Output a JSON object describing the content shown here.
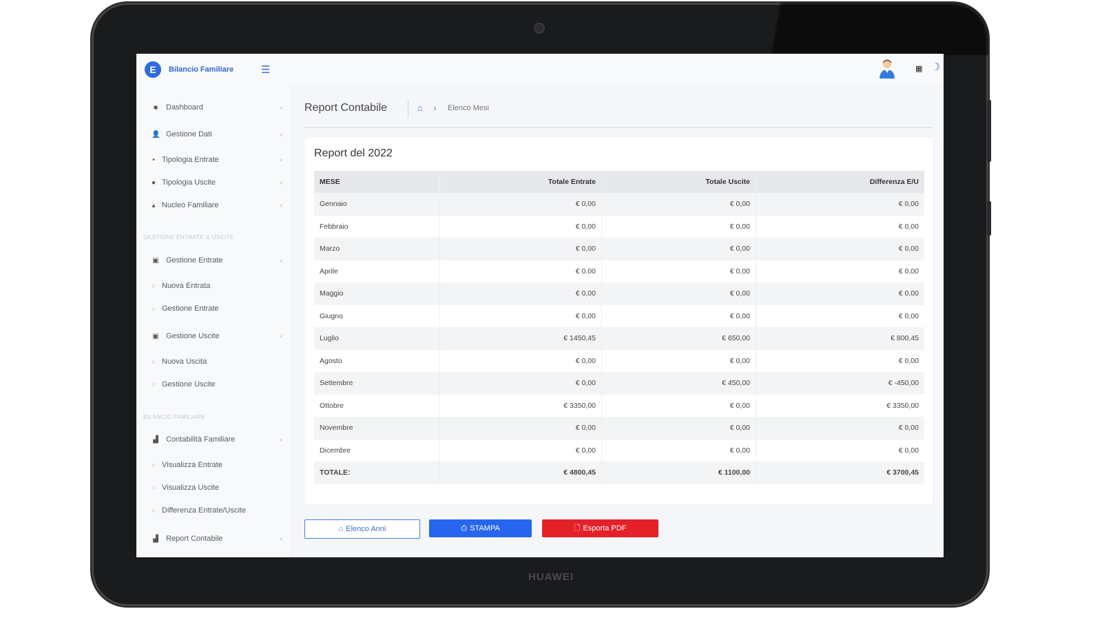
{
  "device": {
    "brand": "HUAWEI"
  },
  "app": {
    "logo_letter": "E",
    "title": "Bilancio Familiare"
  },
  "sidebar": {
    "items": [
      {
        "label": "Dashboard",
        "icon": "home-icon"
      },
      {
        "label": "Gestione Dati",
        "icon": "user-icon"
      },
      {
        "label": "Tipologia Entrate",
        "icon": "dot-icon"
      },
      {
        "label": "Tipologia Uscite",
        "icon": "dot-icon"
      },
      {
        "label": "Nucleo Familiare",
        "icon": "dot-icon"
      }
    ],
    "section1": "GESTIONE ENTRATE & USCITE",
    "entrate": {
      "label": "Gestione Entrate",
      "sub": [
        "Nuova Entrata",
        "Gestione Entrate"
      ]
    },
    "uscite": {
      "label": "Gestione Uscite",
      "sub": [
        "Nuova Uscita",
        "Gestione Uscite"
      ]
    },
    "section2": "BILANCIO FAMILIARE",
    "contabilita": {
      "label": "Contabilità Familiare",
      "sub": [
        "Visualizza Entrate",
        "Visualizza Uscite",
        "Differenza Entrate/Uscite"
      ]
    },
    "report": {
      "label": "Report Contabile"
    }
  },
  "breadcrumb": {
    "title": "Report Contabile",
    "current": "Elenco Mesi"
  },
  "report": {
    "title": "Report del 2022",
    "headers": [
      "MESE",
      "Totale Entrate",
      "Totale Uscite",
      "Differenza E/U"
    ],
    "rows": [
      [
        "Gennaio",
        "€ 0,00",
        "€ 0,00",
        "€ 0,00"
      ],
      [
        "Febbraio",
        "€ 0,00",
        "€ 0,00",
        "€ 0,00"
      ],
      [
        "Marzo",
        "€ 0,00",
        "€ 0,00",
        "€ 0,00"
      ],
      [
        "Aprile",
        "€ 0,00",
        "€ 0,00",
        "€ 0,00"
      ],
      [
        "Maggio",
        "€ 0,00",
        "€ 0,00",
        "€ 0,00"
      ],
      [
        "Giugno",
        "€ 0,00",
        "€ 0,00",
        "€ 0,00"
      ],
      [
        "Luglio",
        "€ 1450,45",
        "€ 650,00",
        "€ 800,45"
      ],
      [
        "Agosto",
        "€ 0,00",
        "€ 0,00",
        "€ 0,00"
      ],
      [
        "Settembre",
        "€ 0,00",
        "€ 450,00",
        "€ -450,00"
      ],
      [
        "Ottobre",
        "€ 3350,00",
        "€ 0,00",
        "€ 3350,00"
      ],
      [
        "Novembre",
        "€ 0,00",
        "€ 0,00",
        "€ 0,00"
      ],
      [
        "Dicembre",
        "€ 0,00",
        "€ 0,00",
        "€ 0,00"
      ]
    ],
    "total": [
      "TOTALE:",
      "€ 4800,45",
      "€ 1100,00",
      "€ 3700,45"
    ]
  },
  "buttons": {
    "years": "Elenco Anni",
    "print": "STAMPA",
    "pdf": "Esporta PDF"
  },
  "colors": {
    "accent": "#2765ee",
    "danger": "#e42028",
    "brand_text": "#3566d6"
  }
}
